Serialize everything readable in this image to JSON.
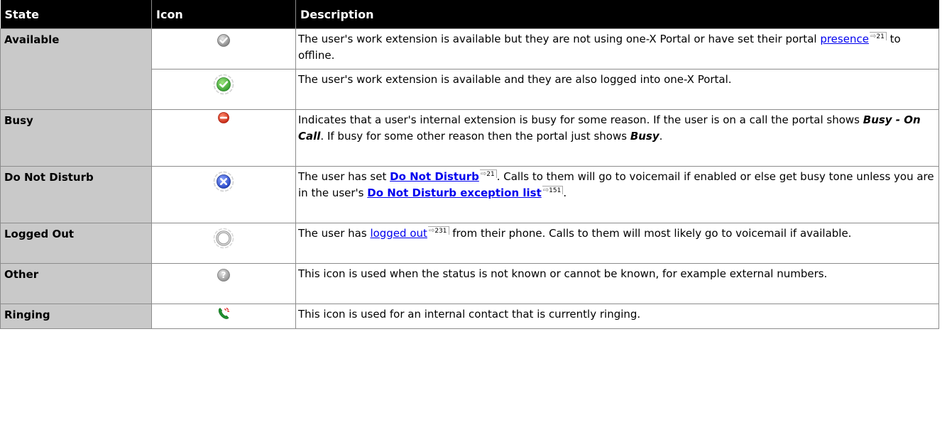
{
  "headers": {
    "state": "State",
    "icon": "Icon",
    "description": "Description"
  },
  "rows": [
    {
      "state": "Available",
      "icon": "grey-check-circle-icon",
      "desc": {
        "t1": "The user's work extension is available but they are not using one-X Portal or have set their portal ",
        "link": "presence",
        "ref": "21",
        "t2": " to offline."
      }
    },
    {
      "icon": "green-check-circle-icon",
      "desc": {
        "t1": "The user's work extension is available and they are also logged into one-X Portal."
      }
    },
    {
      "state": "Busy",
      "icon": "red-no-entry-icon",
      "desc": {
        "t1": "Indicates that a user's internal extension is busy for some reason. If the user is on a call the portal shows ",
        "em1": "Busy - On Call",
        "t2": ". If busy for some other reason then the portal just shows ",
        "em2": "Busy",
        "t3": "."
      }
    },
    {
      "state": "Do Not Disturb",
      "icon": "blue-x-circle-icon",
      "desc": {
        "t1": "The user has set ",
        "link1": "Do Not Disturb",
        "ref1": "21",
        "t2": ". Calls to them will go to voicemail if enabled or else get busy tone unless you are in the user's ",
        "link2": "Do Not Disturb exception list",
        "ref2": "151",
        "t3": "."
      }
    },
    {
      "state": "Logged Out",
      "icon": "grey-ring-icon",
      "desc": {
        "t1": "The user has ",
        "link": "logged out",
        "ref": "231",
        "t2": " from their phone. Calls to them will most likely go to voicemail if available."
      }
    },
    {
      "state": "Other",
      "icon": "question-circle-icon",
      "desc": {
        "t1": "This icon is used when the status is not known or cannot be known, for example external numbers."
      }
    },
    {
      "state": "Ringing",
      "icon": "green-phone-ringing-icon",
      "desc": {
        "t1": "This icon is used for an internal contact that is currently ringing."
      }
    }
  ],
  "colors": {
    "header_bg": "#000000",
    "header_text": "#ffffff",
    "state_col_bg": "#c9c9c9",
    "link": "#0000ee",
    "border": "#8c8c8c"
  }
}
